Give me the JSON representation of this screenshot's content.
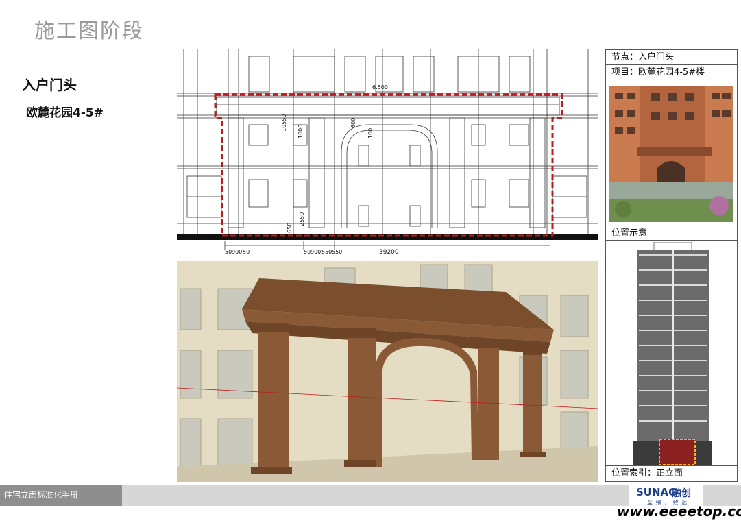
{
  "page": {
    "title": "施工图阶段",
    "section_title": "入户门头",
    "section_subtitle": "欧麓花园4-5#"
  },
  "drawing": {
    "elevation_mark": "6.500",
    "dims": {
      "d1": "50",
      "d2": "900",
      "d3": "50",
      "d4": "50",
      "d5": "900",
      "d6": "550",
      "d7": "550",
      "total": "39200",
      "v1": "10550",
      "v2": "1000",
      "v3": "600",
      "v4": "100",
      "v5": "650",
      "v6": "2550"
    }
  },
  "info_panel": {
    "node": "节点：入户门头",
    "project": "项目：欧麓花园4-5#楼",
    "location_label": "位置示意",
    "index_label": "位置索引：正立面"
  },
  "footer": {
    "manual_title": "住宅立面标准化手册",
    "logo_brand": "SUNAC",
    "logo_cn": "融创",
    "logo_slogan": "至 臻 ， 致 远",
    "watermark": "www.eeeetop.com"
  },
  "colors": {
    "highlight_red": "#c0191c",
    "portal_brown": "#8a5a36",
    "wall_beige": "#e5dcc4",
    "index_yellow": "#f5b700"
  }
}
